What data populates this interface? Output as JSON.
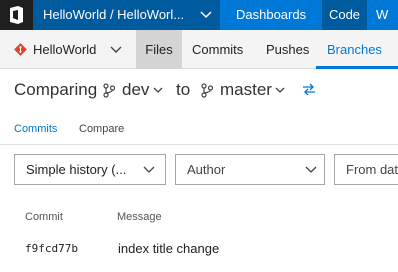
{
  "topbar": {
    "project": "HelloWorld / HelloWorl...",
    "nav": [
      "Dashboards",
      "Code",
      "W"
    ],
    "active": "Code"
  },
  "subbar": {
    "repo": "HelloWorld",
    "items": [
      "Files",
      "Commits",
      "Pushes",
      "Branches"
    ],
    "selected": "Files",
    "current": "Branches"
  },
  "compare": {
    "prefix": "Comparing",
    "source": "dev",
    "joiner": "to",
    "target": "master"
  },
  "tabs": {
    "commits": "Commits",
    "compare": "Compare",
    "active": "Commits"
  },
  "filters": {
    "history": "Simple history (...",
    "author": "Author",
    "from_date": "From dat"
  },
  "table": {
    "headers": {
      "commit": "Commit",
      "message": "Message"
    },
    "rows": [
      {
        "commit": "f9fcd77b",
        "message": "index title change"
      }
    ]
  },
  "colors": {
    "accent": "#0078d7",
    "topbar": "#0078d7",
    "topbar_dark": "#005a9e",
    "git": "#e2412b"
  }
}
